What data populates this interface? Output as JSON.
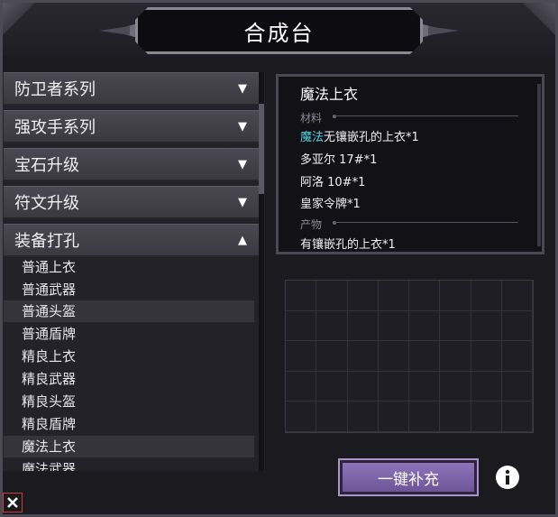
{
  "title": "合成台",
  "categories": [
    {
      "label": "防卫者系列",
      "arrow": "▼"
    },
    {
      "label": "强攻手系列",
      "arrow": "▼"
    },
    {
      "label": "宝石升级",
      "arrow": "▼"
    },
    {
      "label": "符文升级",
      "arrow": "▼"
    },
    {
      "label": "装备打孔",
      "arrow": "▲"
    }
  ],
  "items": [
    "普通上衣",
    "普通武器",
    "普通头盔",
    "普通盾牌",
    "精良上衣",
    "精良武器",
    "精良头盔",
    "精良盾牌",
    "魔法上衣",
    "魔法武器"
  ],
  "recipe": {
    "title": "魔法上衣",
    "materials_label": "材料",
    "materials": [
      {
        "highlight": "魔法",
        "text": "无镶嵌孔的上衣*1"
      },
      {
        "highlight": "",
        "text": "多亚尔 17#*1"
      },
      {
        "highlight": "",
        "text": "阿洛 10#*1"
      },
      {
        "highlight": "",
        "text": "皇家令牌*1"
      }
    ],
    "products_label": "产物",
    "products": [
      "有镶嵌孔的上衣*1"
    ]
  },
  "fill_button": "一键补充",
  "colors": {
    "accent": "#7e66aa",
    "highlight": "#4fd7e8",
    "close": "#d23a3a"
  }
}
